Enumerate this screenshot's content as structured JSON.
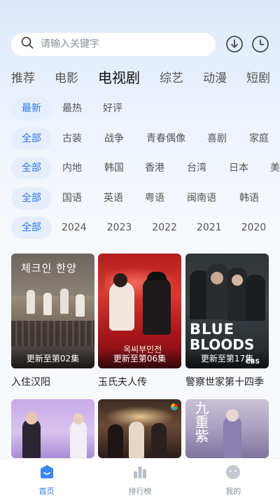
{
  "search": {
    "placeholder": "请输入关键字"
  },
  "icons": {
    "download": "download-icon",
    "history": "history-clock-icon"
  },
  "category_tabs": [
    "推荐",
    "电影",
    "电视剧",
    "综艺",
    "动漫",
    "短剧"
  ],
  "active_tab": "电视剧",
  "filters": {
    "sort": [
      "最新",
      "最热",
      "好评"
    ],
    "genre": [
      "全部",
      "古装",
      "战争",
      "青春偶像",
      "喜剧",
      "家庭"
    ],
    "region": [
      "全部",
      "内地",
      "韩国",
      "香港",
      "台湾",
      "日本",
      "美"
    ],
    "language": [
      "全部",
      "国语",
      "英语",
      "粤语",
      "闽南语",
      "韩语"
    ],
    "year": [
      "全部",
      "2024",
      "2023",
      "2022",
      "2021",
      "2020"
    ]
  },
  "cards": [
    {
      "title": "入住汉阳",
      "badge": "更新至第02集",
      "poster_text": "체크인 한양"
    },
    {
      "title": "玉氏夫人传",
      "badge": "更新至第06集",
      "poster_text": "옥씨부인전"
    },
    {
      "title": "警察世家第十四季",
      "badge": "更新至第17集",
      "poster_text_1": "BLUE",
      "poster_text_2": "BLOODS",
      "network": "CBS"
    },
    {
      "title": "",
      "badge": "",
      "poster_text": ""
    },
    {
      "title": "",
      "badge": "",
      "poster_text": ""
    },
    {
      "title": "",
      "badge": "",
      "poster_text": "九重紫"
    }
  ],
  "bottom_nav": [
    {
      "label": "首页",
      "icon": "home-icon",
      "active": true
    },
    {
      "label": "排行榜",
      "icon": "ranking-bar-icon",
      "active": false
    },
    {
      "label": "我的",
      "icon": "profile-face-icon",
      "active": false
    }
  ],
  "colors": {
    "accent": "#2d78e6",
    "chip_bg": "#e7eefb"
  }
}
